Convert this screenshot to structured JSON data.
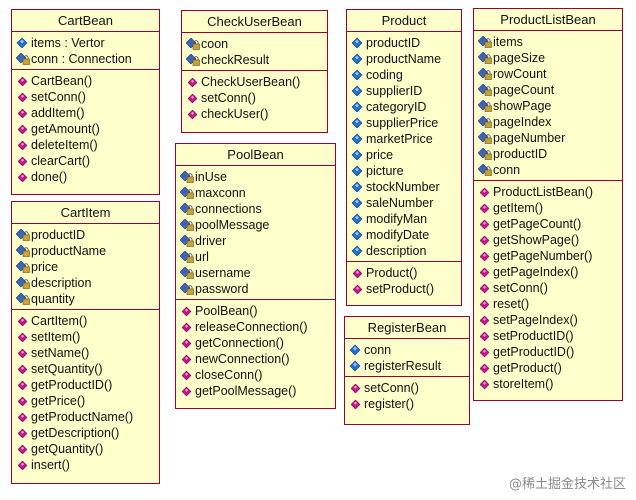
{
  "classes": [
    {
      "id": "cartbean",
      "name": "CartBean",
      "attributes": [
        {
          "text": "items : Vertor",
          "vis": "public"
        },
        {
          "text": "conn : Connection",
          "vis": "private"
        }
      ],
      "methods": [
        "CartBean()",
        "setConn()",
        "addItem()",
        "getAmount()",
        "deleteItem()",
        "clearCart()",
        "done()"
      ]
    },
    {
      "id": "cartitem",
      "name": "CartItem",
      "attributes": [
        {
          "text": "productID",
          "vis": "private"
        },
        {
          "text": "productName",
          "vis": "private"
        },
        {
          "text": "price",
          "vis": "private"
        },
        {
          "text": "description",
          "vis": "private"
        },
        {
          "text": "quantity",
          "vis": "private"
        }
      ],
      "methods": [
        "CartItem()",
        "setItem()",
        "setName()",
        "setQuantity()",
        "getProductID()",
        "getPrice()",
        "getProductName()",
        "getDescription()",
        "getQuantity()",
        "insert()"
      ]
    },
    {
      "id": "checkuserbean",
      "name": "CheckUserBean",
      "attributes": [
        {
          "text": "coon",
          "vis": "private"
        },
        {
          "text": "checkResult",
          "vis": "private"
        }
      ],
      "methods": [
        "CheckUserBean()",
        "setConn()",
        "checkUser()"
      ]
    },
    {
      "id": "poolbean",
      "name": "PoolBean",
      "attributes": [
        {
          "text": "inUse",
          "vis": "private"
        },
        {
          "text": "maxconn",
          "vis": "private"
        },
        {
          "text": "connections",
          "vis": "private"
        },
        {
          "text": "poolMessage",
          "vis": "private"
        },
        {
          "text": "driver",
          "vis": "private"
        },
        {
          "text": "url",
          "vis": "private"
        },
        {
          "text": "username",
          "vis": "private"
        },
        {
          "text": "password",
          "vis": "private"
        }
      ],
      "methods": [
        "PoolBean()",
        "releaseConnection()",
        "getConnection()",
        "newConnection()",
        "closeConn()",
        "getPoolMessage()"
      ]
    },
    {
      "id": "product",
      "name": "Product",
      "attributes": [
        {
          "text": "productID",
          "vis": "public"
        },
        {
          "text": "productName",
          "vis": "public"
        },
        {
          "text": "coding",
          "vis": "public"
        },
        {
          "text": "supplierID",
          "vis": "public"
        },
        {
          "text": "categoryID",
          "vis": "public"
        },
        {
          "text": "supplierPrice",
          "vis": "public"
        },
        {
          "text": "marketPrice",
          "vis": "public"
        },
        {
          "text": "price",
          "vis": "public"
        },
        {
          "text": "picture",
          "vis": "public"
        },
        {
          "text": "stockNumber",
          "vis": "public"
        },
        {
          "text": "saleNumber",
          "vis": "public"
        },
        {
          "text": "modifyMan",
          "vis": "public"
        },
        {
          "text": "modifyDate",
          "vis": "public"
        },
        {
          "text": "description",
          "vis": "public"
        }
      ],
      "methods": [
        "Product()",
        "setProduct()"
      ]
    },
    {
      "id": "registerbean",
      "name": "RegisterBean",
      "attributes": [
        {
          "text": "conn",
          "vis": "public"
        },
        {
          "text": "registerResult",
          "vis": "public"
        }
      ],
      "methods": [
        "setConn()",
        "register()"
      ]
    },
    {
      "id": "productlistbean",
      "name": "ProductListBean",
      "attributes": [
        {
          "text": "items",
          "vis": "private"
        },
        {
          "text": "pageSize",
          "vis": "private"
        },
        {
          "text": "rowCount",
          "vis": "private"
        },
        {
          "text": "pageCount",
          "vis": "private"
        },
        {
          "text": "showPage",
          "vis": "private"
        },
        {
          "text": "pageIndex",
          "vis": "private"
        },
        {
          "text": "pageNumber",
          "vis": "private"
        },
        {
          "text": "productID",
          "vis": "private"
        },
        {
          "text": "conn",
          "vis": "private"
        }
      ],
      "methods": [
        "ProductListBean()",
        "getItem()",
        "getPageCount()",
        "getShowPage()",
        "getPageNumber()",
        "getPageIndex()",
        "setConn()",
        "reset()",
        "setPageIndex()",
        "setProductID()",
        "getProductID()",
        "getProduct()",
        "storeItem()"
      ]
    }
  ],
  "colors": {
    "box_fill": "#ffffcc",
    "box_border": "#990033",
    "public_icon": "#1f6fd6",
    "private_icon": "#3a66b8",
    "lock": "#c9a23a",
    "method_icon": "#c8148c"
  },
  "watermark": "@稀土掘金技术社区"
}
